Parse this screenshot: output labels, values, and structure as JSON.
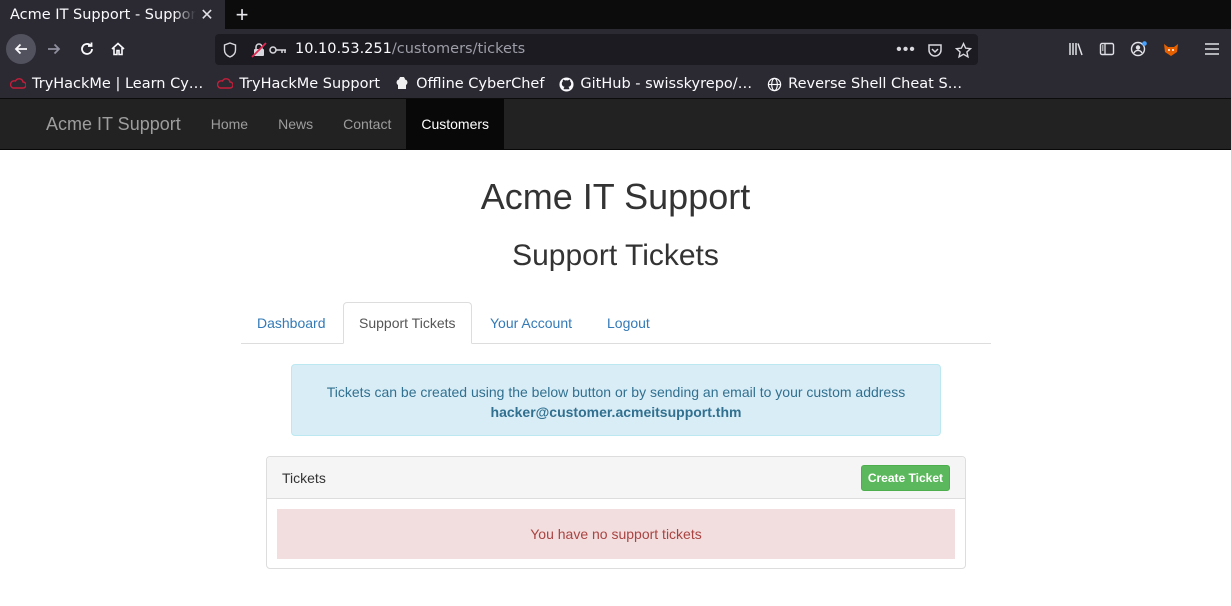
{
  "browser": {
    "tab_title": "Acme IT Support - Support Tickets",
    "url_host": "10.10.53.251",
    "url_path": "/customers/tickets",
    "bookmarks": [
      {
        "label": "TryHackMe | Learn Cy…",
        "icon": "thm-icon"
      },
      {
        "label": "TryHackMe Support",
        "icon": "thm-icon"
      },
      {
        "label": "Offline CyberChef",
        "icon": "chef-hat-icon"
      },
      {
        "label": "GitHub - swisskyrepo/…",
        "icon": "github-icon"
      },
      {
        "label": "Reverse Shell Cheat S…",
        "icon": "globe-icon"
      }
    ]
  },
  "site": {
    "brand": "Acme IT Support",
    "nav": [
      "Home",
      "News",
      "Contact",
      "Customers"
    ],
    "active_nav": "Customers",
    "heading": "Acme IT Support",
    "subheading": "Support Tickets",
    "tabs": [
      "Dashboard",
      "Support Tickets",
      "Your Account",
      "Logout"
    ],
    "active_tab": "Support Tickets",
    "alert_text": "Tickets can be created using the below button or by sending an email to your custom address",
    "alert_email": "hacker@customer.acmeitsupport.thm",
    "panel_title": "Tickets",
    "create_button": "Create Ticket",
    "empty_message": "You have no support tickets"
  },
  "colors": {
    "link": "#337ab7",
    "success": "#5cb85c",
    "info_bg": "#d9edf7",
    "danger_bg": "#f2dede"
  }
}
